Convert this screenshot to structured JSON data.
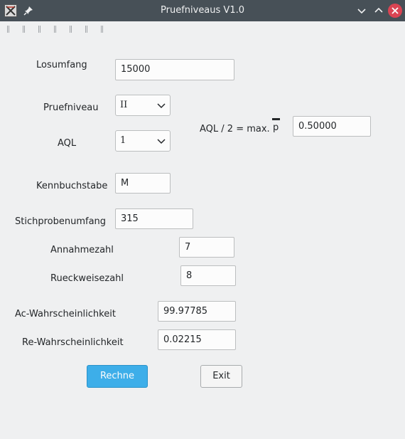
{
  "window": {
    "title": "Pruefniveaus V1.0",
    "icons": [
      "app-icon",
      "pin-icon",
      "minimize-icon",
      "maximize-icon",
      "close-icon"
    ]
  },
  "form": {
    "losumfang": {
      "label": "Losumfang",
      "value": "15000"
    },
    "pruefniveau": {
      "label": "Pruefniveau",
      "value": "II"
    },
    "aql": {
      "label": "AQL",
      "value": "1"
    },
    "aql_half": {
      "label": "AQL / 2 = max.",
      "symbol": "p",
      "value": "0.50000"
    },
    "kennbuchstabe": {
      "label": "Kennbuchstabe",
      "value": "M"
    },
    "stichprobenumfang": {
      "label": "Stichprobenumfang",
      "value": "315"
    },
    "annahmezahl": {
      "label": "Annahmezahl",
      "value": "7"
    },
    "rueckweisezahl": {
      "label": "Rueckweisezahl",
      "value": "8"
    },
    "ac_wahrscheinlichkeit": {
      "label": "Ac-Wahrscheinlichkeit",
      "value": "99.97785"
    },
    "re_wahrscheinlichkeit": {
      "label": "Re-Wahrscheinlichkeit",
      "value": "0.02215"
    }
  },
  "buttons": {
    "rechne": "Rechne",
    "exit": "Exit"
  },
  "colors": {
    "titlebar": "#475057",
    "background": "#eff0f1",
    "primary_button": "#3daee9",
    "close_button": "#da4453"
  }
}
